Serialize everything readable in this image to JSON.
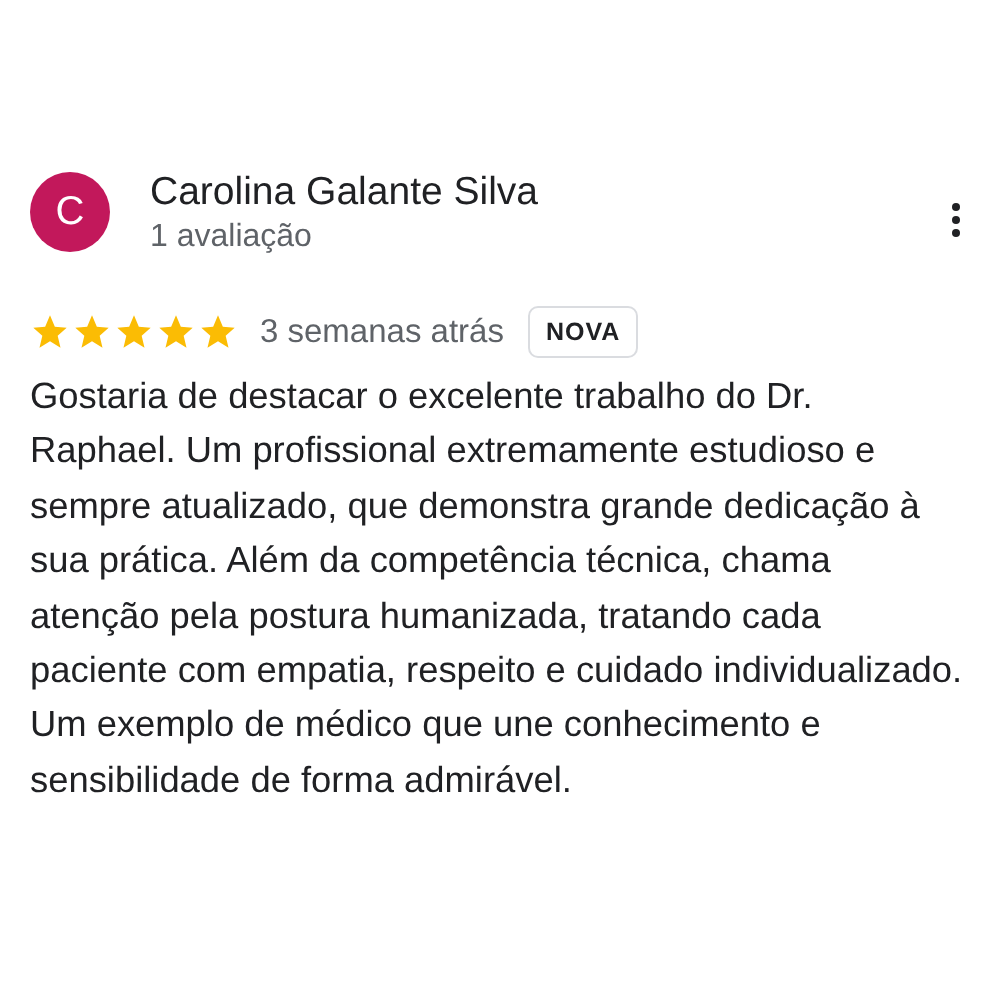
{
  "review": {
    "avatar_letter": "C",
    "author": "Carolina Galante Silva",
    "author_meta": "1 avaliação",
    "stars": 5,
    "time": "3 semanas atrás",
    "badge": "NOVA",
    "text": "Gostaria de destacar o excelente trabalho do Dr. Raphael. Um profissional extremamente estudioso e sempre atualizado, que demonstra grande dedicação à sua prática. Além da competência técnica, chama atenção pela postura humanizada, tratando cada paciente com empatia, respeito e cuidado individualizado. Um exemplo de médico que une conhecimento e sensibilidade de forma admirável."
  }
}
